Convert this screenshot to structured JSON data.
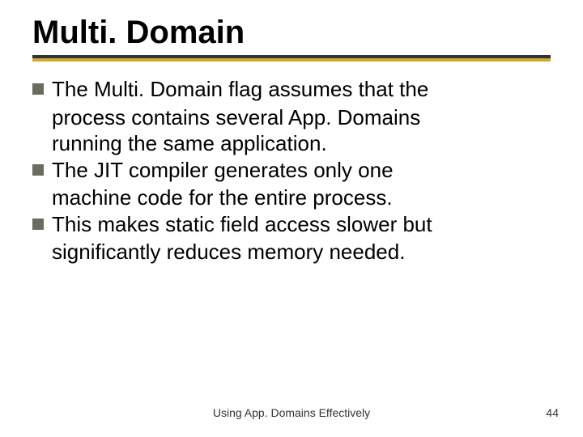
{
  "title": "Multi. Domain",
  "bullets": [
    {
      "lead": "The Multi. Domain flag assumes that the",
      "cont": [
        "process contains several App. Domains",
        "running the same application."
      ]
    },
    {
      "lead": "The JIT compiler generates only one",
      "cont": [
        "machine code for the entire process."
      ]
    },
    {
      "lead": "This makes static field access slower but",
      "cont": [
        "significantly reduces memory needed."
      ]
    }
  ],
  "footer": "Using App. Domains Effectively",
  "page": "44"
}
